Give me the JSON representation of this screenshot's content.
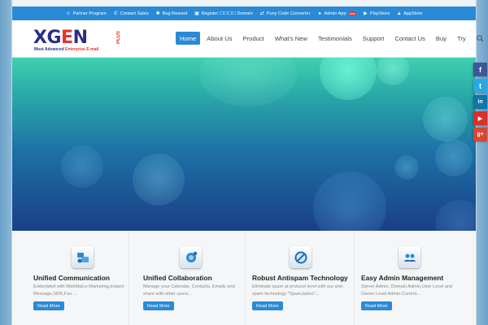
{
  "topbar": {
    "items": [
      {
        "icon": "partner-icon",
        "label": "Partner Program"
      },
      {
        "icon": "phone-icon",
        "label": "Contact Sales"
      },
      {
        "icon": "bug-icon",
        "label": "Bug Reward"
      },
      {
        "icon": "register-icon",
        "label": "Register ☐☐☐☐ Domain"
      },
      {
        "icon": "convert-icon",
        "label": "Puny Code Converter"
      },
      {
        "icon": "admin-user-icon",
        "label": "Admin App",
        "badge": "new"
      },
      {
        "icon": "playstore-icon",
        "label": "PlayStore"
      },
      {
        "icon": "appstore-icon",
        "label": "AppStore"
      }
    ]
  },
  "logo": {
    "word_1": "XG",
    "word_o": "E",
    "word_2": "N",
    "plus": "PLUS",
    "tag_1": "Most Advanced ",
    "tag_hl": "Enterprise E-mail"
  },
  "nav": {
    "items": [
      "Home",
      "About Us",
      "Product",
      "What's New",
      "Testimonials",
      "Support",
      "Contact Us",
      "Buy",
      "Try"
    ],
    "active": "Home"
  },
  "features": [
    {
      "title": "Unified Communication",
      "desc": "Embedded with WebMail,e-Marketing,Instant Message,SMS,Fax ...",
      "button": "Read More",
      "icon": "communication-icon"
    },
    {
      "title": "Unified Collaboration",
      "desc": "Manage your Calendar, Contacts, Emails and share with other users...",
      "button": "Read More",
      "icon": "collaboration-icon"
    },
    {
      "title": "Robust Antispam Technology",
      "desc": "Eliminate spam at protocol level with our anti-spam technology \"SpamJadoo\"...",
      "button": "Read More",
      "icon": "antispam-icon"
    },
    {
      "title": "Easy Admin Management",
      "desc": "Server Admin, Domain Admin,User Level and Owner Level Admin Control...",
      "button": "Read More",
      "icon": "admin-icon"
    }
  ],
  "social": [
    {
      "name": "facebook",
      "glyph": "f",
      "color": "#3b5998"
    },
    {
      "name": "twitter",
      "glyph": "t",
      "color": "#29a9e1"
    },
    {
      "name": "linkedin",
      "glyph": "in",
      "color": "#0e76a8"
    },
    {
      "name": "youtube",
      "glyph": "▶",
      "color": "#d9302a"
    },
    {
      "name": "googleplus",
      "glyph": "g+",
      "color": "#d34836"
    }
  ],
  "colors": {
    "accent": "#2a8ad6",
    "brand_navy": "#2b2e86",
    "brand_red": "#e8322a"
  }
}
